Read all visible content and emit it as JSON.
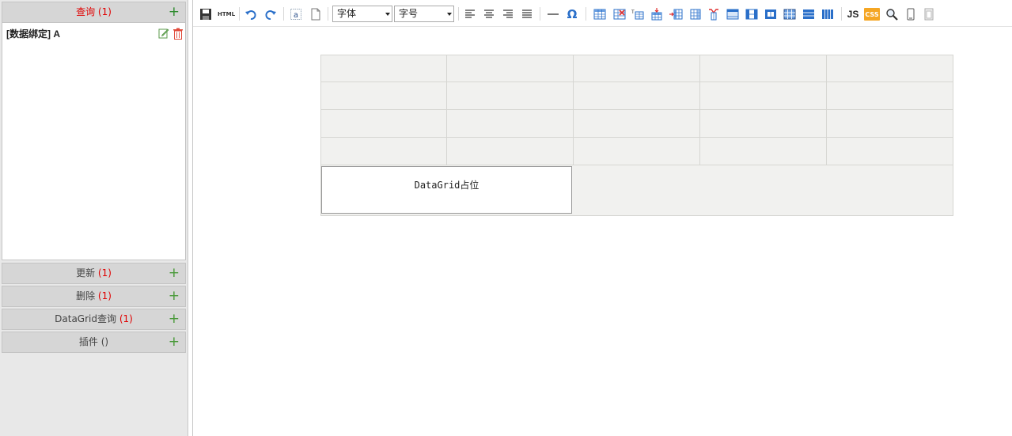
{
  "left_panel": {
    "query": {
      "label": "查询",
      "count": "(1)",
      "items": [
        {
          "label": "[数据绑定] A"
        }
      ]
    },
    "sections": [
      {
        "label": "更新",
        "count": "(1)"
      },
      {
        "label": "删除",
        "count": "(1)"
      },
      {
        "label": "DataGrid查询",
        "count": "(1)"
      },
      {
        "label": "插件",
        "count": "()"
      }
    ]
  },
  "toolbar": {
    "html_label": "HTML",
    "font_family": "字体",
    "font_size": "字号",
    "js_label": "JS",
    "css_label": "CSS",
    "omega": "Ω"
  },
  "editor": {
    "datagrid_placeholder": "DataGrid占位"
  },
  "colors": {
    "accent_red": "#e00000",
    "plus_green": "#4a9a3a",
    "icon_blue": "#2a6fc9",
    "css_orange": "#f5a623"
  }
}
